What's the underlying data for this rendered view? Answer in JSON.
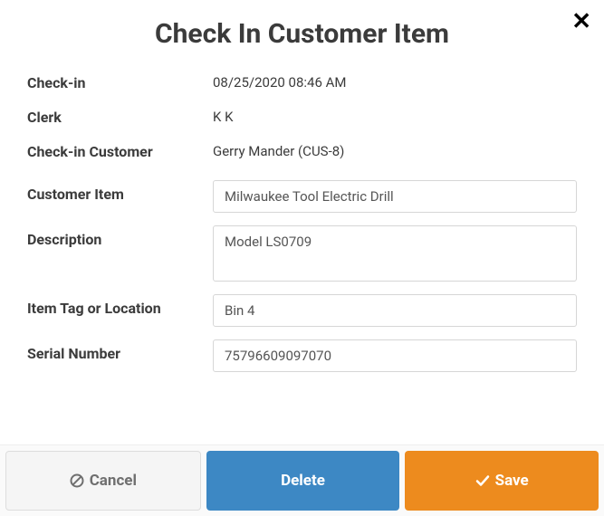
{
  "header": {
    "title": "Check In Customer Item"
  },
  "fields": {
    "checkin_label": "Check-in",
    "checkin_value": "08/25/2020 08:46 AM",
    "clerk_label": "Clerk",
    "clerk_value": "K K",
    "customer_label": "Check-in Customer",
    "customer_value": "Gerry Mander (CUS-8)",
    "item_label": "Customer Item",
    "item_value": "Milwaukee Tool Electric Drill",
    "description_label": "Description",
    "description_value": "Model LS0709",
    "tag_label": "Item Tag or Location",
    "tag_value": "Bin 4",
    "serial_label": "Serial Number",
    "serial_value": "75796609097070"
  },
  "buttons": {
    "cancel": "Cancel",
    "delete": "Delete",
    "save": "Save"
  }
}
